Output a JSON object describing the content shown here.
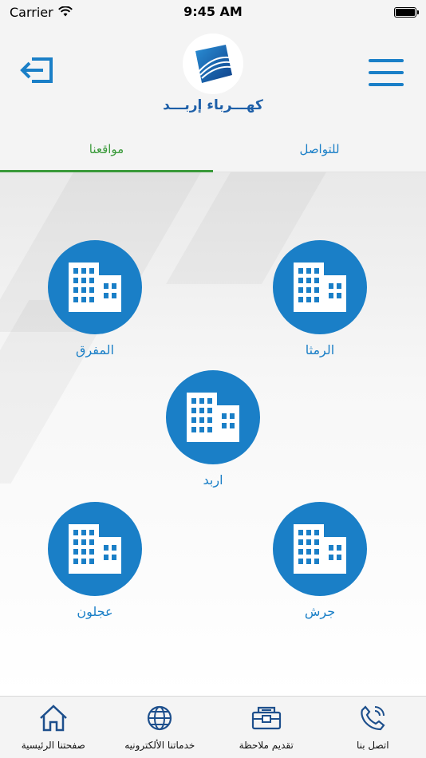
{
  "status_bar": {
    "carrier": "Carrier",
    "time": "9:45 AM",
    "battery_level": 1.0
  },
  "header": {
    "logo_text": "كهـــرباء إربـــد",
    "logo_icon": "company-logo-icon",
    "logout_icon": "logout-icon",
    "menu_icon": "hamburger-menu-icon"
  },
  "tabs": [
    {
      "label": "مواقعنا",
      "active": true
    },
    {
      "label": "للتواصل",
      "active": false
    }
  ],
  "branches": {
    "mafraq": "المفرق",
    "ramtha": "الرمثا",
    "irbid": "اربد",
    "ajloun": "عجلون",
    "jerash": "جرش"
  },
  "bottom_nav": {
    "home": "صفحتنا الرئيسية",
    "services": "خدماتنا الألكترونيه",
    "feedback": "تقديم ملاحظة",
    "contact": "اتصل بنا"
  },
  "colors": {
    "accent": "#1a7fc7",
    "active_tab": "#3a9a3a",
    "logo_text": "#1d5fa8"
  }
}
